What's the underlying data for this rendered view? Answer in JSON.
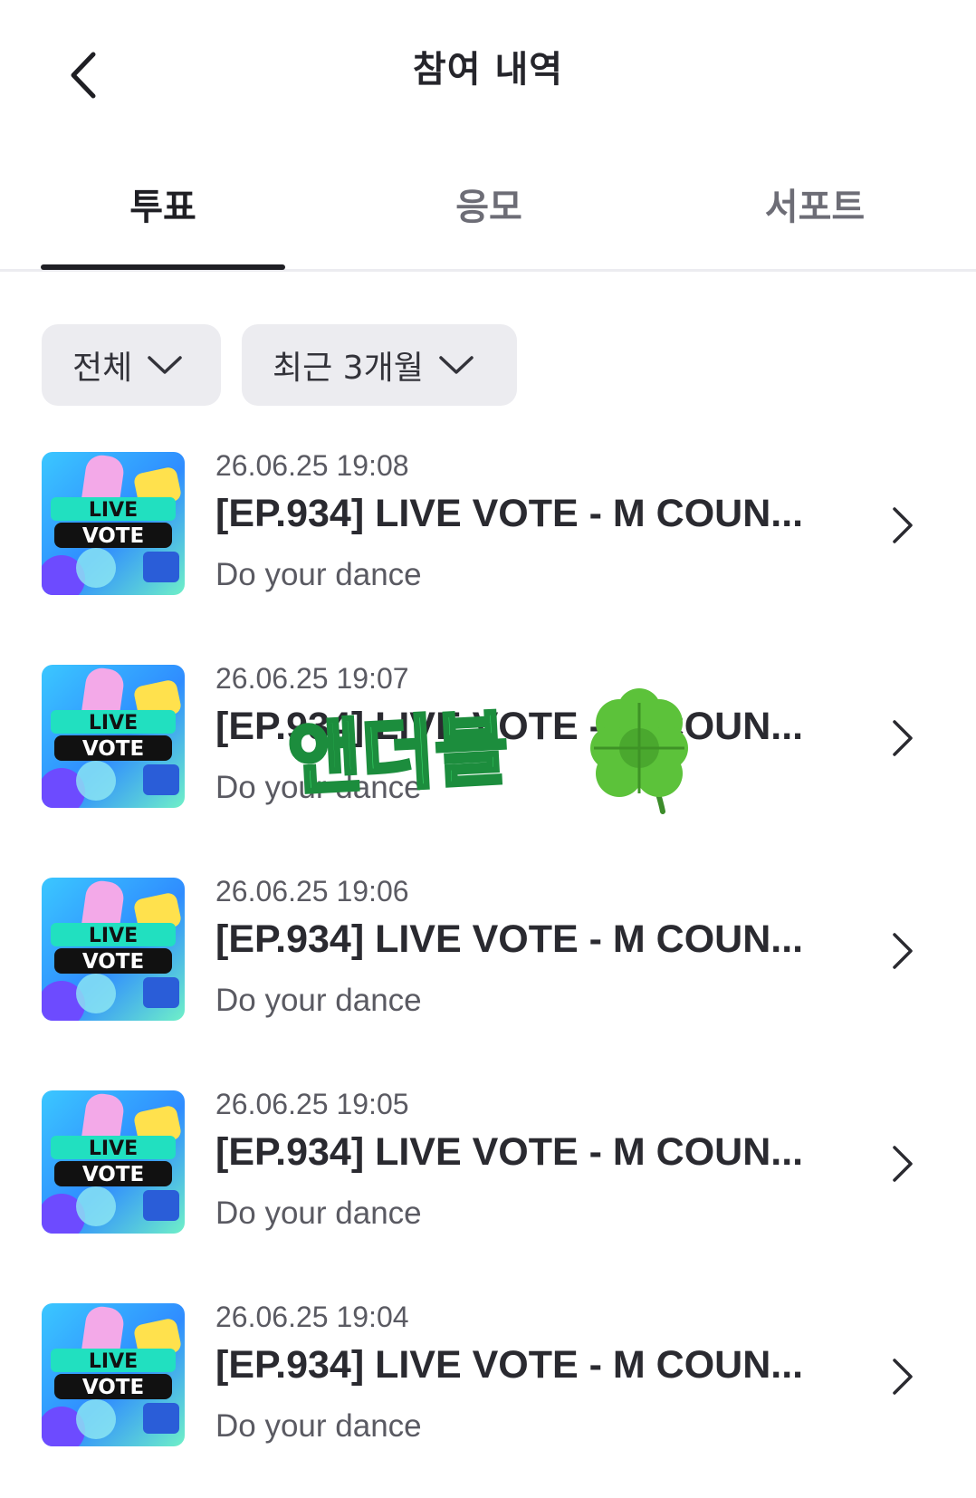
{
  "header": {
    "title": "참여 내역"
  },
  "tabs": [
    {
      "label": "투표",
      "active": true
    },
    {
      "label": "응모",
      "active": false
    },
    {
      "label": "서포트",
      "active": false
    }
  ],
  "filters": {
    "category": "전체",
    "period": "최근 3개월"
  },
  "items": [
    {
      "date": "26.06.25 19:08",
      "title": "[EP.934] LIVE VOTE - M COUN...",
      "subtitle": "Do your dance",
      "thumb_line1": "LIVE",
      "thumb_line2": "VOTE"
    },
    {
      "date": "26.06.25 19:07",
      "title": "[EP.934] LIVE VOTE - M COUN...",
      "subtitle": "Do your dance",
      "thumb_line1": "LIVE",
      "thumb_line2": "VOTE"
    },
    {
      "date": "26.06.25 19:06",
      "title": "[EP.934] LIVE VOTE - M COUN...",
      "subtitle": "Do your dance",
      "thumb_line1": "LIVE",
      "thumb_line2": "VOTE"
    },
    {
      "date": "26.06.25 19:05",
      "title": "[EP.934] LIVE VOTE - M COUN...",
      "subtitle": "Do your dance",
      "thumb_line1": "LIVE",
      "thumb_line2": "VOTE"
    },
    {
      "date": "26.06.25 19:04",
      "title": "[EP.934] LIVE VOTE - M COUN...",
      "subtitle": "Do your dance",
      "thumb_line1": "LIVE",
      "thumb_line2": "VOTE"
    }
  ],
  "watermark": {
    "text": "앤더블",
    "icon": "four-leaf-clover-icon"
  },
  "colors": {
    "text": "#1f1f24",
    "muted": "#5a5a62",
    "chip": "#ececf0",
    "accent_green": "#3be36f"
  },
  "icons": {
    "back": "chevron-left-icon",
    "dropdown": "chevron-down-icon",
    "row": "chevron-right-icon"
  }
}
